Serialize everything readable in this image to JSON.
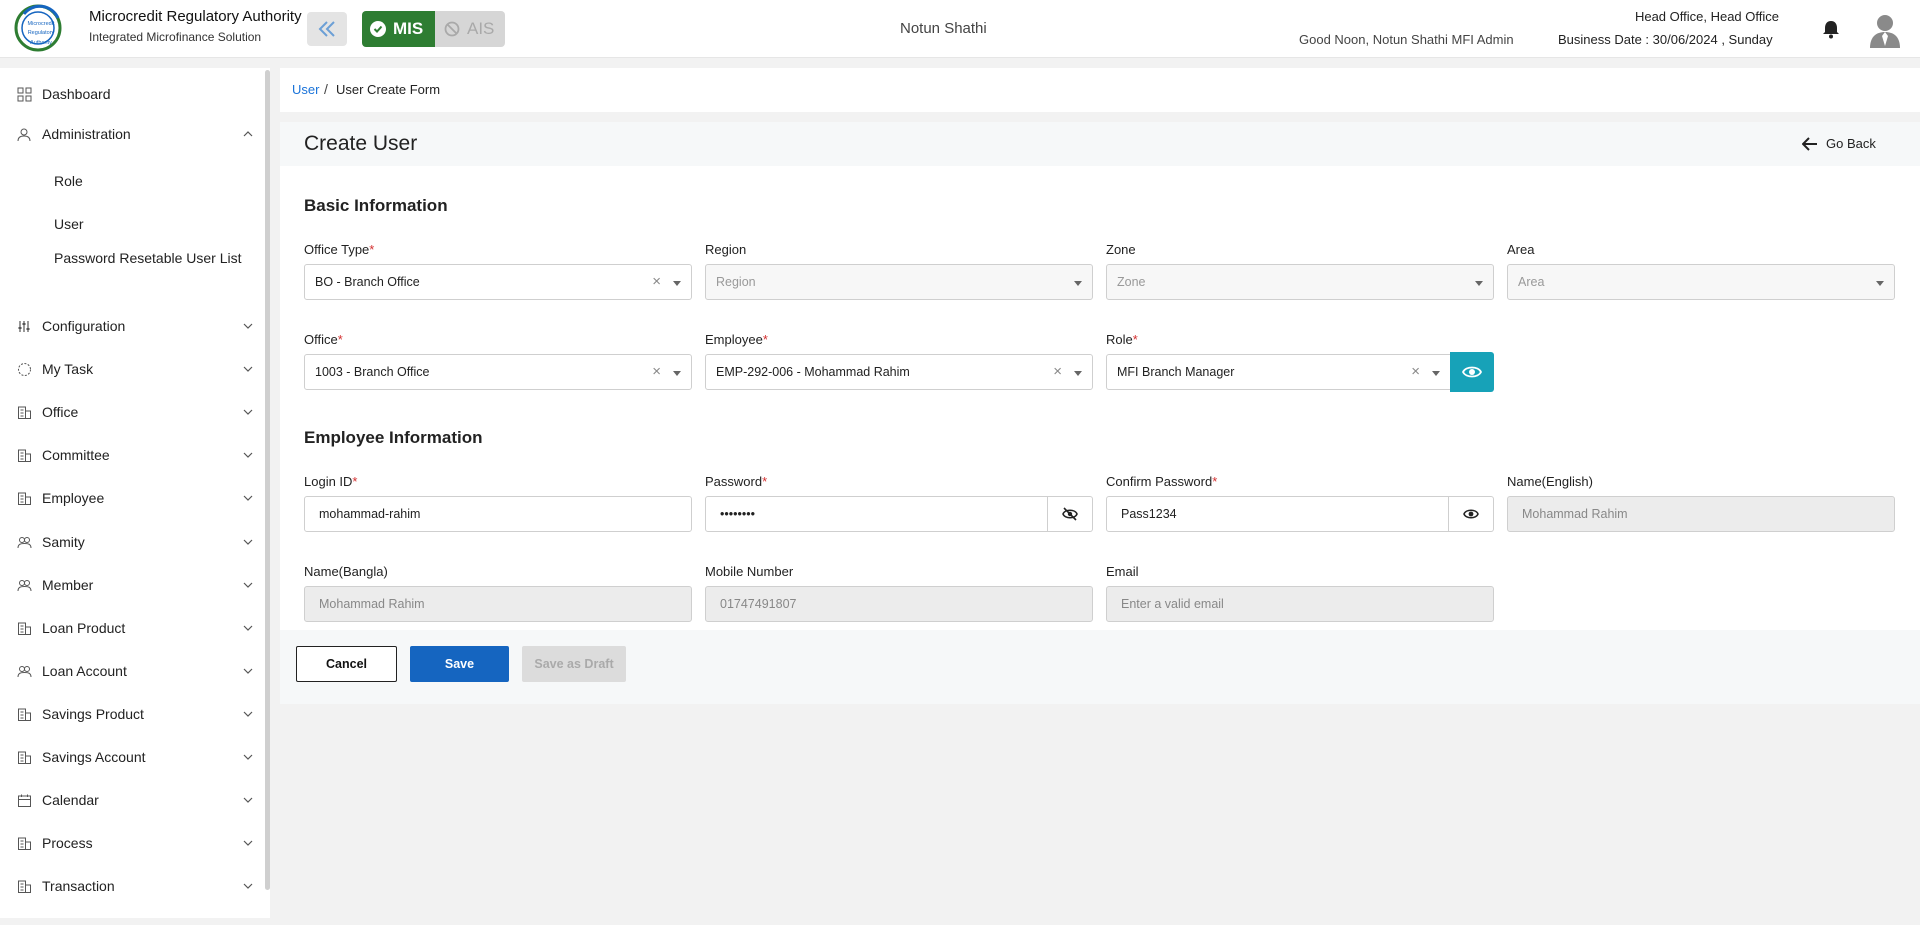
{
  "header": {
    "brand_title": "Microcredit Regulatory Authority",
    "brand_subtitle": "Integrated Microfinance Solution",
    "logo_text_1": "Microcredit",
    "logo_text_2": "Regulatory",
    "logo_text_3": "Authority",
    "mis_label": "MIS",
    "ais_label": "AIS",
    "org_name": "Notun Shathi",
    "greeting": "Good Noon, Notun Shathi MFI Admin",
    "office": "Head Office, Head Office",
    "business_date": "Business Date : 30/06/2024 , Sunday",
    "colors": {
      "mis_active": "#2e7d32",
      "accent": "#1565c0"
    }
  },
  "sidebar": {
    "dashboard": "Dashboard",
    "administration": "Administration",
    "admin_sub": [
      "Role",
      "User",
      "Password Resetable User List"
    ],
    "items": [
      "Configuration",
      "My Task",
      "Office",
      "Committee",
      "Employee",
      "Samity",
      "Member",
      "Loan Product",
      "Loan Account",
      "Savings Product",
      "Savings Account",
      "Calendar",
      "Process",
      "Transaction"
    ]
  },
  "breadcrumb": {
    "parent": "User",
    "separator": "/",
    "current": "User Create Form"
  },
  "form": {
    "title": "Create User",
    "go_back": "Go Back",
    "basic_section": "Basic Information",
    "employee_section": "Employee Information",
    "office_type": {
      "label": "Office Type",
      "value": "BO - Branch Office"
    },
    "region": {
      "label": "Region",
      "placeholder": "Region"
    },
    "zone": {
      "label": "Zone",
      "placeholder": "Zone"
    },
    "area": {
      "label": "Area",
      "placeholder": "Area"
    },
    "office": {
      "label": "Office",
      "value": "1003 - Branch Office"
    },
    "employee": {
      "label": "Employee",
      "value": "EMP-292-006 - Mohammad Rahim"
    },
    "role": {
      "label": "Role",
      "value": "MFI Branch Manager"
    },
    "login_id": {
      "label": "Login ID",
      "value": "mohammad-rahim"
    },
    "password": {
      "label": "Password",
      "value": "Pass1234"
    },
    "confirm_password": {
      "label": "Confirm Password",
      "value": "Pass1234"
    },
    "name_english": {
      "label": "Name(English)",
      "placeholder": "Mohammad Rahim"
    },
    "name_bangla": {
      "label": "Name(Bangla)",
      "placeholder": "Mohammad Rahim"
    },
    "mobile": {
      "label": "Mobile Number",
      "placeholder": "01747491807"
    },
    "email": {
      "label": "Email",
      "placeholder": "Enter a valid email"
    },
    "required_mark": "*",
    "clear_mark": "×"
  },
  "actions": {
    "cancel": "Cancel",
    "save": "Save",
    "save_draft": "Save as Draft"
  }
}
